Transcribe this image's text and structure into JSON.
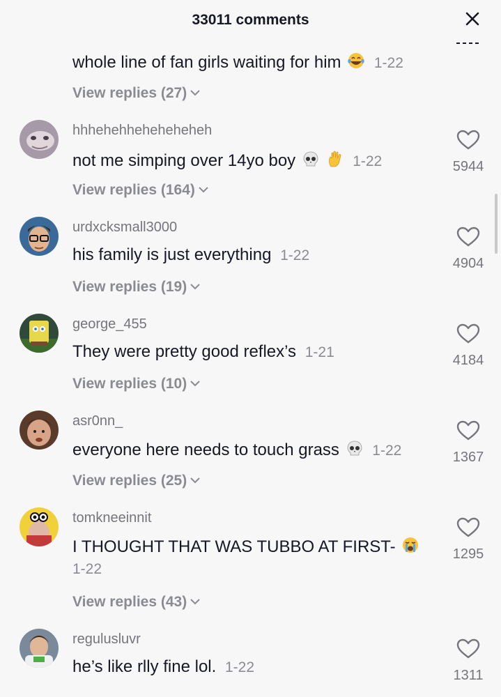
{
  "header": {
    "title": "33011 comments"
  },
  "comments": [
    {
      "username": "",
      "text": "whole line of fan girls waiting for him",
      "emojis": [
        "laughing-tears"
      ],
      "date": "1-22",
      "replies": "View replies (27)",
      "likes": ""
    },
    {
      "username": "hhhehehheheheheheh",
      "text": "not me simping over 14yo boy",
      "emojis": [
        "skull",
        "raised-hand"
      ],
      "date": "1-22",
      "replies": "View replies (164)",
      "likes": "5944"
    },
    {
      "username": "urdxcksmall3000",
      "text": "his family is just everything",
      "emojis": [],
      "date": "1-22",
      "replies": "View replies (19)",
      "likes": "4904"
    },
    {
      "username": "george_455",
      "text": "They were pretty good reflex’s",
      "emojis": [],
      "date": "1-21",
      "replies": "View replies (10)",
      "likes": "4184"
    },
    {
      "username": "asr0nn_",
      "text": "everyone here needs to touch grass",
      "emojis": [
        "skull"
      ],
      "date": "1-22",
      "replies": "View replies (25)",
      "likes": "1367"
    },
    {
      "username": "tomkneeinnit",
      "text": "I THOUGHT THAT WAS TUBBO AT FIRST-",
      "emojis": [
        "crying"
      ],
      "date": "1-22",
      "replies": "View replies (43)",
      "likes": "1295"
    },
    {
      "username": "regulusluvr",
      "text": "he’s like rlly fine lol.",
      "emojis": [],
      "date": "1-22",
      "replies": "",
      "likes": "1311"
    }
  ],
  "colors": {
    "background": "#f7f7f8",
    "text": "#161823",
    "secondary": "#75757b",
    "muted": "#8a8b91"
  }
}
